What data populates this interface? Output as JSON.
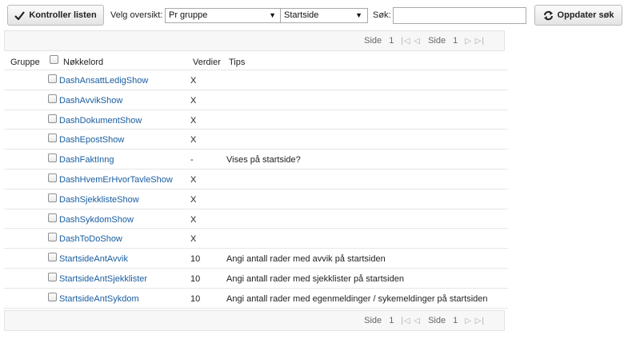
{
  "toolbar": {
    "check_button_label": "Kontroller listen",
    "view_label": "Velg oversikt:",
    "view_value": "Pr gruppe",
    "page_value": "Startside",
    "search_label": "Søk:",
    "search_value": "",
    "refresh_button_label": "Oppdater søk",
    "dropdown_glyph": "▼"
  },
  "pager": {
    "side_label": "Side",
    "current_page": "1",
    "total_pages": "1",
    "first_prev_glyph": "|◁ ◁",
    "next_last_glyph": "▷ ▷|"
  },
  "table": {
    "headers": {
      "group": "Gruppe",
      "keyword": "Nøkkelord",
      "values": "Verdier",
      "tips": "Tips"
    },
    "rows": [
      {
        "keyword": "DashAnsattLedigShow",
        "value": "X",
        "tip": ""
      },
      {
        "keyword": "DashAvvikShow",
        "value": "X",
        "tip": ""
      },
      {
        "keyword": "DashDokumentShow",
        "value": "X",
        "tip": ""
      },
      {
        "keyword": "DashEpostShow",
        "value": "X",
        "tip": ""
      },
      {
        "keyword": "DashFaktInng",
        "value": "-",
        "tip": "Vises på startside?"
      },
      {
        "keyword": "DashHvemErHvorTavleShow",
        "value": "X",
        "tip": ""
      },
      {
        "keyword": "DashSjekklisteShow",
        "value": "X",
        "tip": ""
      },
      {
        "keyword": "DashSykdomShow",
        "value": "X",
        "tip": ""
      },
      {
        "keyword": "DashToDoShow",
        "value": "X",
        "tip": ""
      },
      {
        "keyword": "StartsideAntAvvik",
        "value": "10",
        "tip": "Angi antall rader med avvik på startsiden"
      },
      {
        "keyword": "StartsideAntSjekklister",
        "value": "10",
        "tip": "Angi antall rader med sjekklister på startsiden"
      },
      {
        "keyword": "StartsideAntSykdom",
        "value": "10",
        "tip": "Angi antall rader med egenmeldinger / sykemeldinger på startsiden"
      }
    ]
  }
}
